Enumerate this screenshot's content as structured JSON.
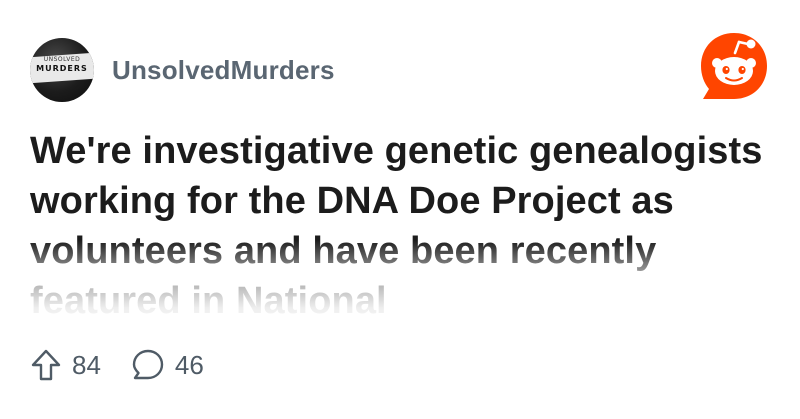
{
  "subreddit": {
    "name": "UnsolvedMurders",
    "avatar_text_top": "UNSOLVED",
    "avatar_text_main": "MURDERS"
  },
  "post": {
    "title": "We're investigative genetic genealogists working for the DNA Doe Project as volunteers and have been recently featured in National"
  },
  "stats": {
    "upvotes": "84",
    "comments": "46"
  },
  "icons": {
    "brand": "reddit-logo-icon",
    "upvote": "upvote-arrow-icon",
    "comment": "comment-bubble-icon"
  },
  "colors": {
    "brand_orange": "#ff4500",
    "title_text": "#1c1c1c",
    "muted_text": "#5a6672"
  }
}
